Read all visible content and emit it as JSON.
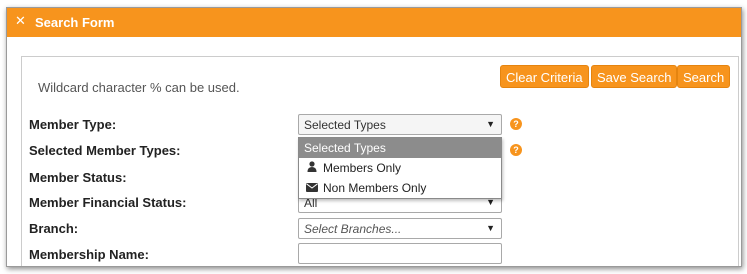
{
  "window": {
    "title": "Search Form",
    "close_glyph": "✕"
  },
  "hint": "Wildcard character % can be used.",
  "buttons": {
    "clear": "Clear Criteria",
    "save": "Save Search",
    "search": "Search"
  },
  "fields": {
    "member_type": {
      "label": "Member Type:",
      "value": "Selected Types"
    },
    "selected_member_types": {
      "label": "Selected Member Types:"
    },
    "member_status": {
      "label": "Member Status:"
    },
    "member_financial_status": {
      "label": "Member Financial Status:",
      "value": "All"
    },
    "branch": {
      "label": "Branch:",
      "placeholder": "Select Branches..."
    },
    "membership_name": {
      "label": "Membership Name:",
      "value": ""
    }
  },
  "dropdown": {
    "header": "Selected Types",
    "items": [
      {
        "label": "Members Only",
        "icon": "person-icon"
      },
      {
        "label": "Non Members Only",
        "icon": "envelope-icon"
      }
    ]
  },
  "colors": {
    "accent": "#f7941d",
    "dropdown_header": "#8c8c8c"
  }
}
